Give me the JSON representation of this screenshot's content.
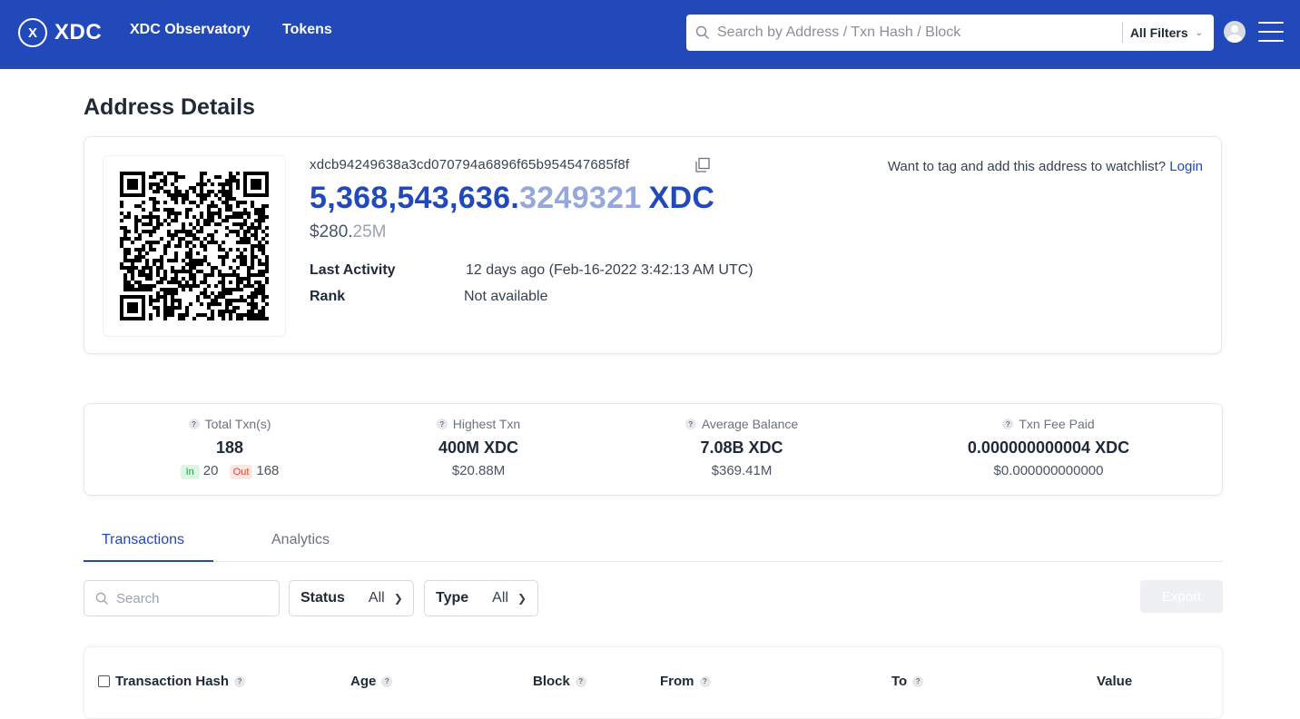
{
  "header": {
    "logo_mark": "X",
    "logo_text": "XDC",
    "nav": [
      "XDC Observatory",
      "Tokens"
    ],
    "search_placeholder": "Search by Address / Txn Hash / Block",
    "filter_label": "All Filters",
    "icons": {
      "search": "search-icon",
      "avatar": "user-icon",
      "menu": "hamburger-icon"
    },
    "bg_color": "#2149b9"
  },
  "page": {
    "title": "Address Details"
  },
  "address_card": {
    "address": "xdcb94249638a3cd070794a6896f65b954547685f8f",
    "balance_int": "5,368,543,636.",
    "balance_dec": "3249321",
    "balance_unit": "XDC",
    "usd_int": "$280.",
    "usd_dec": "25M",
    "last_activity_label": "Last Activity",
    "last_activity_value": "12 days ago (Feb-16-2022 3:42:13 AM UTC)",
    "rank_label": "Rank",
    "rank_value": "Not available",
    "watch_text": "Want to tag and add this address to watchlist?",
    "login_label": "Login"
  },
  "stats": [
    {
      "title": "Total Txn(s)",
      "main": "188",
      "in_label": "In",
      "in_value": "20",
      "out_label": "Out",
      "out_value": "168"
    },
    {
      "title": "Highest Txn",
      "main": "400M XDC",
      "sub": "$20.88M"
    },
    {
      "title": "Average Balance",
      "main": "7.08B XDC",
      "sub": "$369.41M"
    },
    {
      "title": "Txn Fee Paid",
      "main": "0.000000000004 XDC",
      "sub": "$0.000000000000"
    }
  ],
  "tabs": [
    "Transactions",
    "Analytics"
  ],
  "filters": {
    "search_placeholder": "Search",
    "status_label": "Status",
    "status_value": "All",
    "type_label": "Type",
    "type_value": "All",
    "export_label": "Export"
  },
  "table": {
    "columns": [
      "Transaction Hash",
      "Age",
      "Block",
      "From",
      "To",
      "Value"
    ]
  }
}
